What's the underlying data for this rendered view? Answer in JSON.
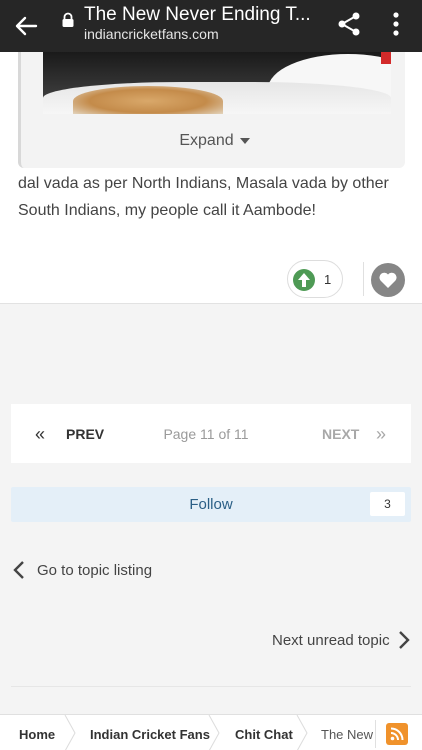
{
  "browser": {
    "title": "The New Never Ending T...",
    "url": "indiancricketfans.com"
  },
  "post": {
    "expand_label": "Expand",
    "text": "dal vada as per North Indians, Masala vada by other South Indians, my people call it Aambode!",
    "reaction_count": "1"
  },
  "pagination": {
    "prev_label": "PREV",
    "page_label": "Page 11 of 11",
    "next_label": "NEXT"
  },
  "follow": {
    "label": "Follow",
    "count": "3"
  },
  "nav": {
    "go_to_listing": "Go to topic listing",
    "next_unread": "Next unread topic"
  },
  "breadcrumb": {
    "items": [
      "Home",
      "Indian Cricket Fans",
      "Chit Chat",
      "The New"
    ]
  },
  "colors": {
    "topbar": "#262626",
    "upvote": "#4e9a55",
    "follow_bg": "#e4eff8",
    "rss": "#f0922b"
  },
  "icons": [
    "back-arrow-icon",
    "lock-icon",
    "share-icon",
    "more-vert-icon",
    "caret-down-icon",
    "upvote-icon",
    "heart-icon",
    "double-chevron-left-icon",
    "double-chevron-right-icon",
    "chevron-left-icon",
    "chevron-right-icon",
    "rss-icon"
  ]
}
